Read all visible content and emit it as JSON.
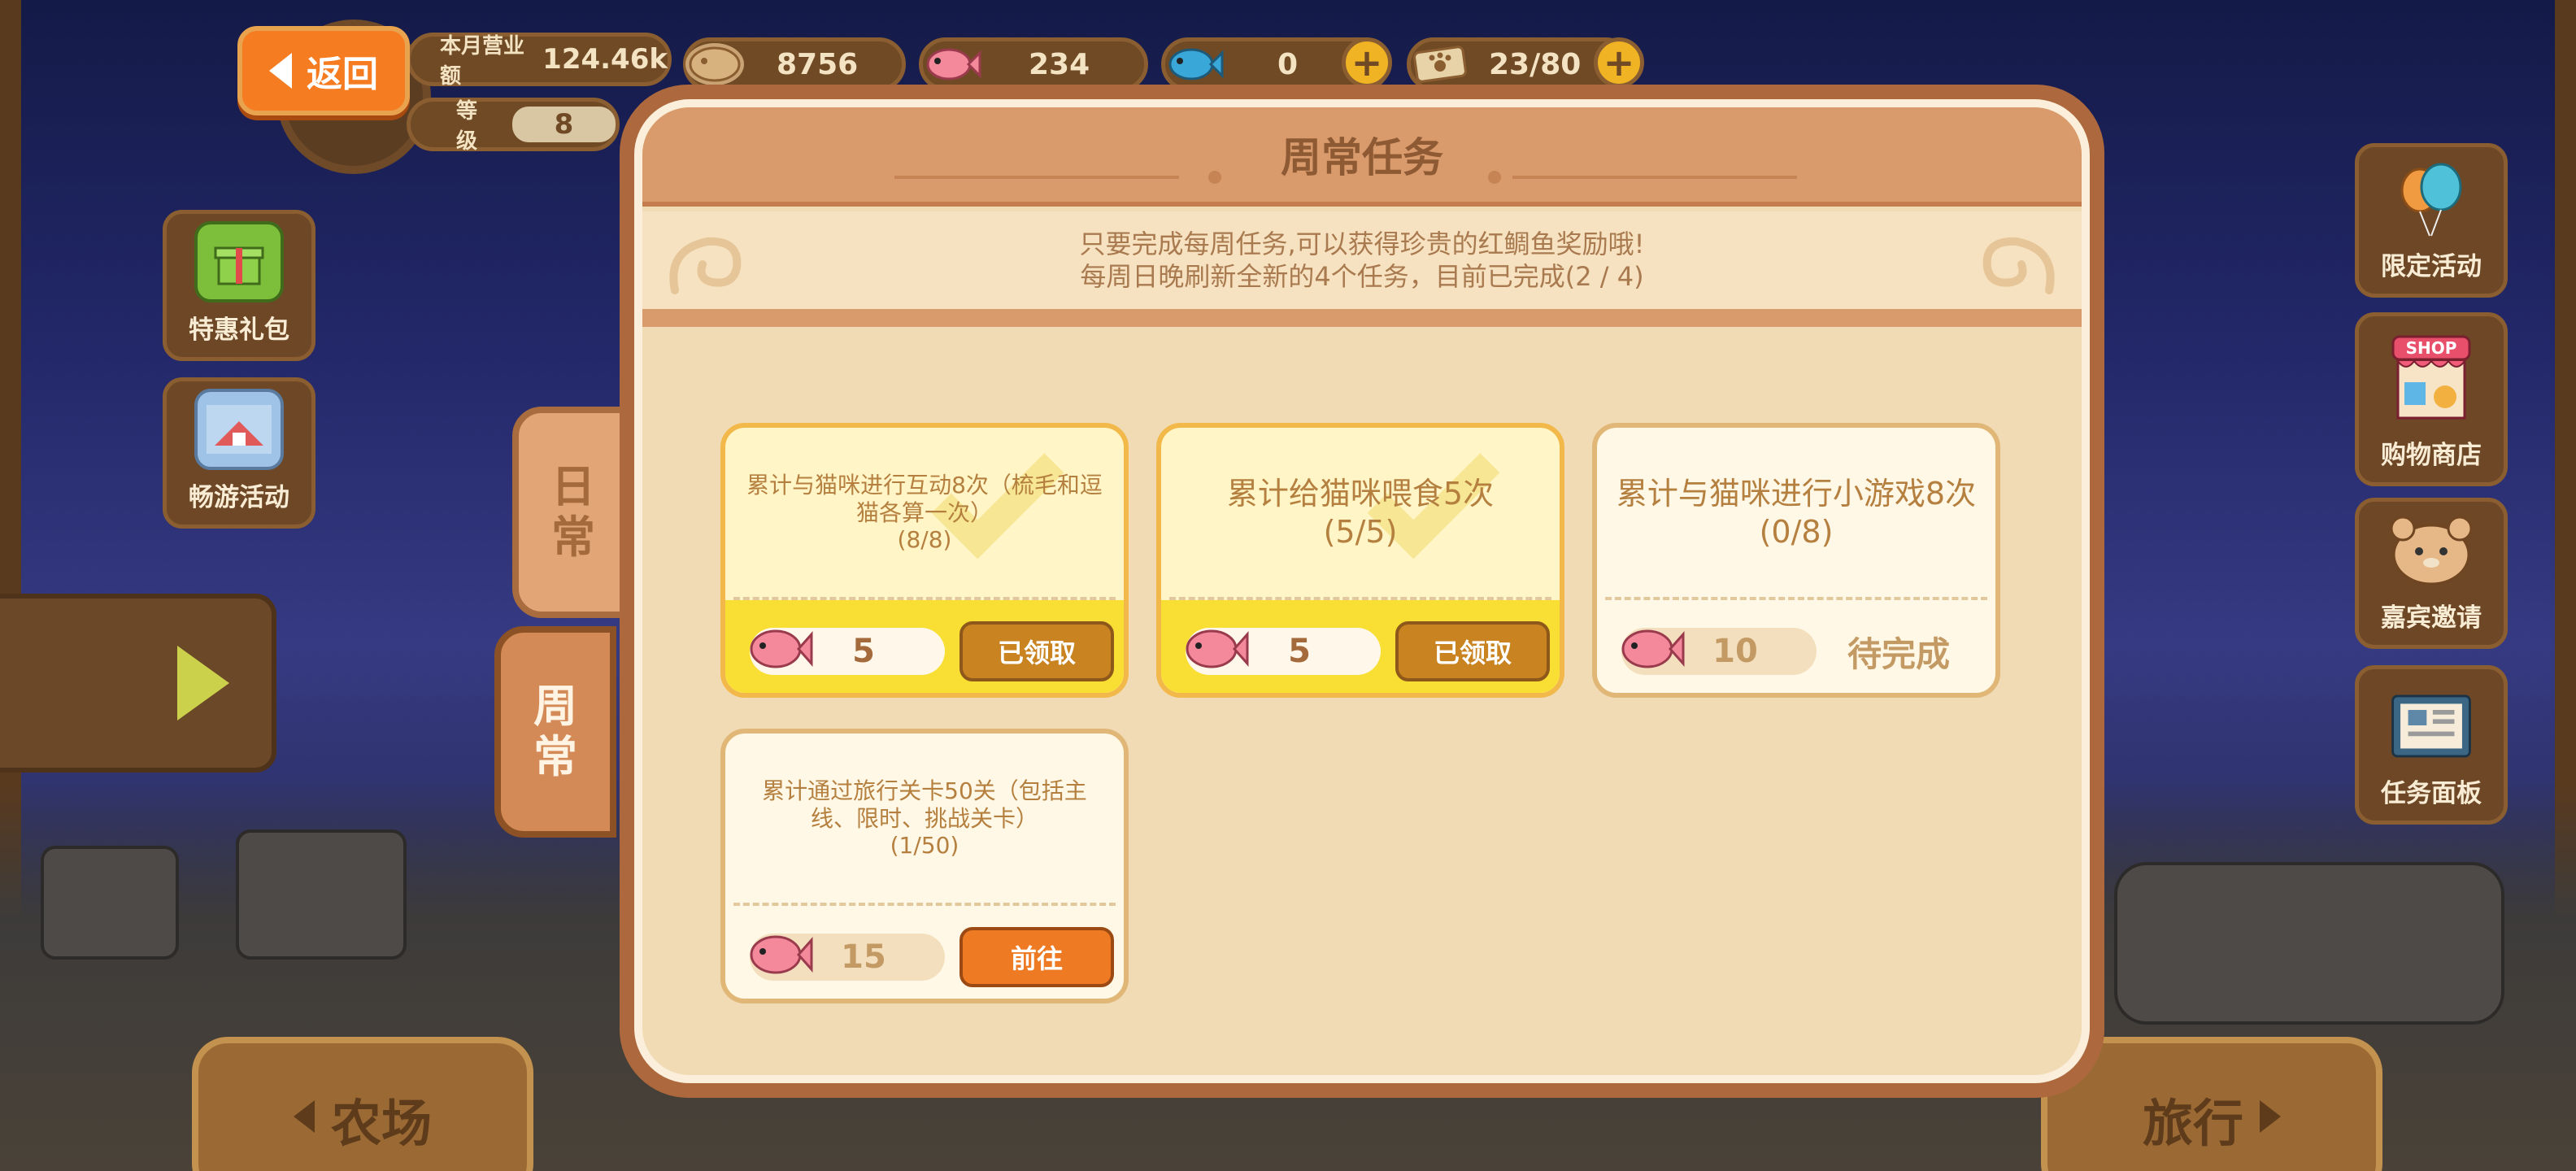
{
  "hud": {
    "back_label": "返回",
    "monthly_label": "本月营业额",
    "monthly_value": "124.46k",
    "level_label": "等级",
    "level_value": "8",
    "resources": [
      {
        "icon": "coin-icon",
        "value": "8756"
      },
      {
        "icon": "pink-fish-icon",
        "value": "234"
      },
      {
        "icon": "blue-fish-icon",
        "value": "0"
      },
      {
        "icon": "paw-ticket-icon",
        "value": "23/80"
      }
    ]
  },
  "left_side": {
    "buttons": [
      {
        "label": "特惠礼包",
        "icon": "gift-icon"
      },
      {
        "label": "畅游活动",
        "icon": "scenery-icon"
      }
    ]
  },
  "right_side": {
    "buttons": [
      {
        "label": "限定活动",
        "icon": "balloon-icon"
      },
      {
        "label": "购物商店",
        "icon": "shop-icon"
      },
      {
        "label": "嘉宾邀请",
        "icon": "hamster-icon"
      },
      {
        "label": "任务面板",
        "icon": "task-board-icon"
      }
    ]
  },
  "bottom_nav": {
    "farm_label": "农场",
    "travel_label": "旅行"
  },
  "tabs": {
    "daily": [
      "日",
      "常"
    ],
    "weekly": [
      "周",
      "常"
    ]
  },
  "panel": {
    "title": "周常任务",
    "info_line1": "只要完成每周任务,可以获得珍贵的红鲷鱼奖励哦!",
    "info_line2": "每周日晚刷新全新的4个任务，目前已完成(2 / 4)"
  },
  "tasks": [
    {
      "desc": "累计与猫咪进行互动8次（梳毛和逗猫各算一次）",
      "progress": "(8/8)",
      "reward": "5",
      "state": "claimed",
      "action": "已领取"
    },
    {
      "desc": "累计给猫咪喂食5次",
      "progress": "(5/5)",
      "reward": "5",
      "state": "claimed",
      "action": "已领取"
    },
    {
      "desc": "累计与猫咪进行小游戏8次",
      "progress": "(0/8)",
      "reward": "10",
      "state": "pending",
      "action": "待完成"
    },
    {
      "desc": "累计通过旅行关卡50关（包括主线、限时、挑战关卡）",
      "progress": "(1/50)",
      "reward": "15",
      "state": "go",
      "action": "前往"
    }
  ],
  "colors": {
    "panel_border": "#ad693d",
    "card_done_bg": "#f9df33",
    "go_button": "#ee7b24",
    "claimed_button": "#c98320"
  }
}
